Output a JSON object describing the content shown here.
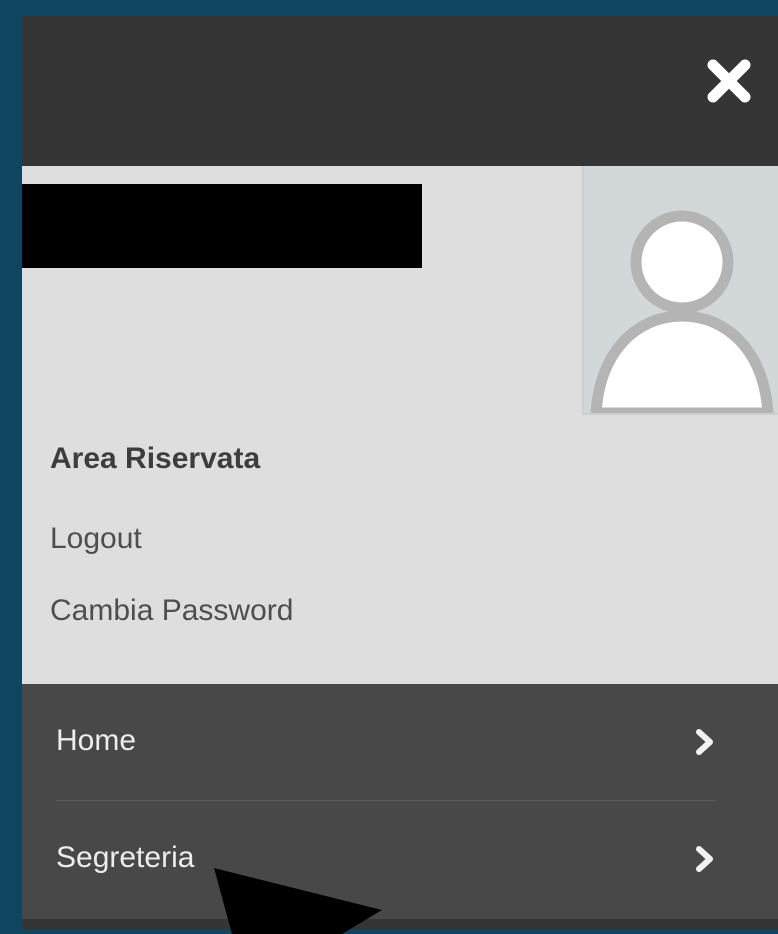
{
  "sidebar": {
    "close_icon": "close-icon",
    "profile": {
      "area_title": "Area Riservata",
      "logout_label": "Logout",
      "change_password_label": "Cambia Password",
      "avatar_icon": "user-avatar-icon"
    },
    "menu": {
      "items": [
        {
          "label": "Home",
          "icon": "chevron-right-icon"
        },
        {
          "label": "Segreteria",
          "icon": "chevron-right-icon"
        }
      ]
    }
  },
  "colors": {
    "background": "#0f4560",
    "topbar": "#353535",
    "profile_bg": "#dedede",
    "menu_bg": "#484848",
    "menu_text": "#ededed"
  }
}
